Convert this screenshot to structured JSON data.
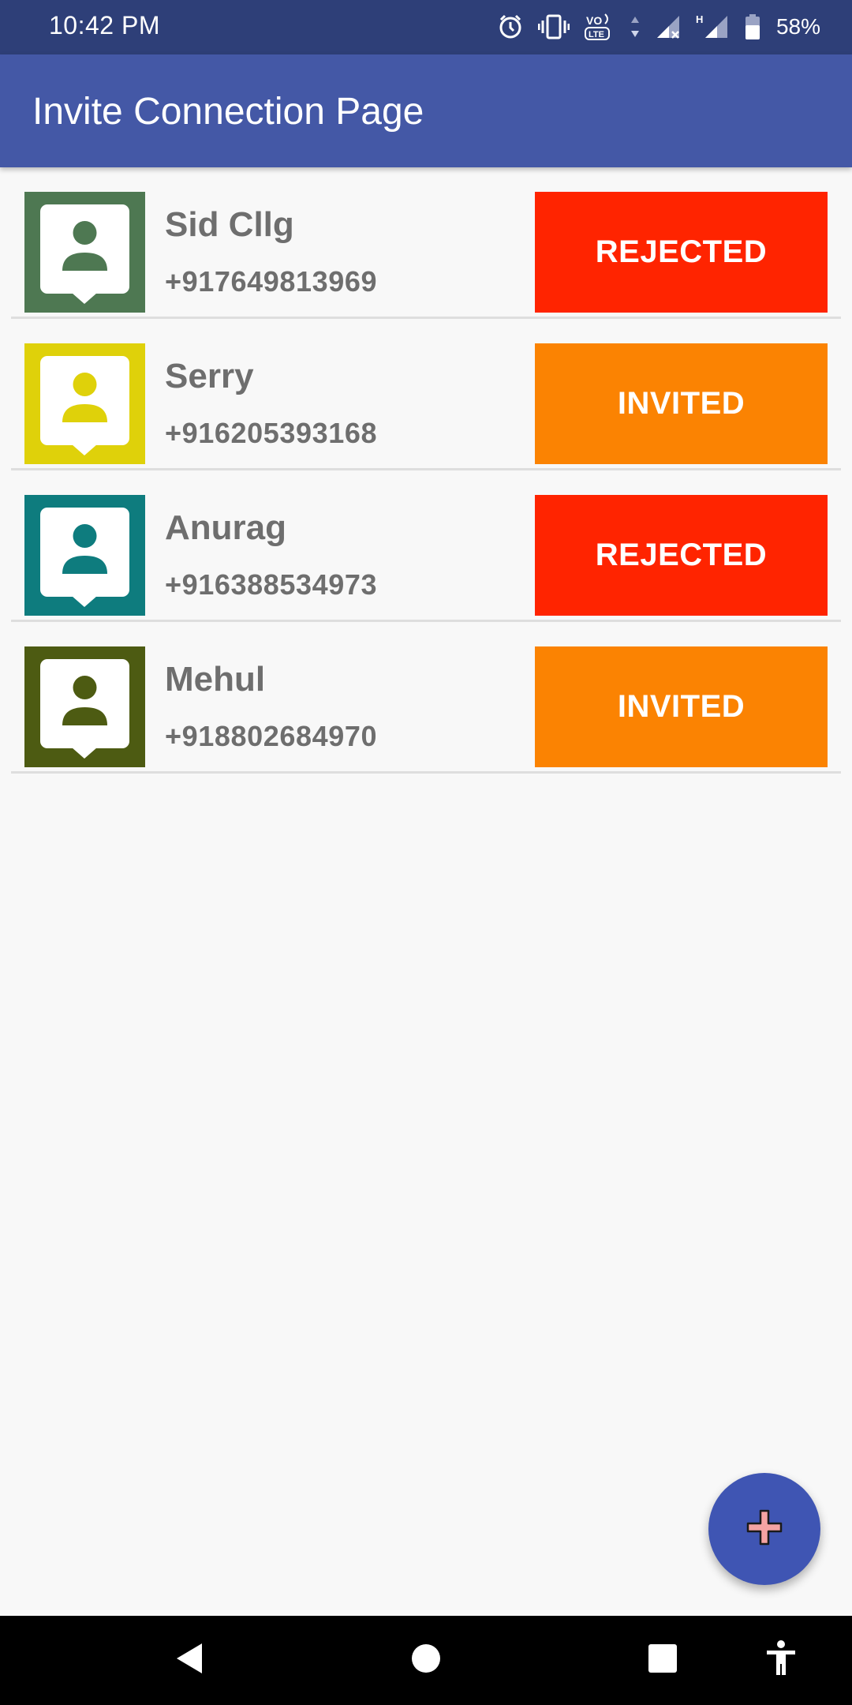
{
  "status_bar": {
    "time": "10:42 PM",
    "battery": "58%",
    "icons": [
      "alarm-icon",
      "vibrate-icon",
      "volte-icon",
      "signal-icon",
      "signal-h-icon",
      "battery-icon"
    ]
  },
  "app_bar": {
    "title": "Invite Connection Page"
  },
  "contacts": [
    {
      "name": "Sid Cllg",
      "phone": "+917649813969",
      "status": "REJECTED",
      "avatar_color": "#4e7852",
      "status_color": "#ff2400"
    },
    {
      "name": "Serry",
      "phone": "+916205393168",
      "status": "INVITED",
      "avatar_color": "#dfd10a",
      "status_color": "#fb8302"
    },
    {
      "name": "Anurag",
      "phone": "+916388534973",
      "status": "REJECTED",
      "avatar_color": "#0e7c7e",
      "status_color": "#ff2400"
    },
    {
      "name": "Mehul",
      "phone": "+918802684970",
      "status": "INVITED",
      "avatar_color": "#4d5b12",
      "status_color": "#fb8302"
    }
  ],
  "fab": {
    "icon": "plus-icon"
  },
  "nav_bar": {
    "icons": [
      "back-icon",
      "home-icon",
      "recents-icon",
      "accessibility-icon"
    ]
  },
  "colors": {
    "status_bar": "#2e3f78",
    "app_bar": "#4458a6",
    "fab": "#3f55b3",
    "rejected": "#ff2400",
    "invited": "#fb8302"
  }
}
